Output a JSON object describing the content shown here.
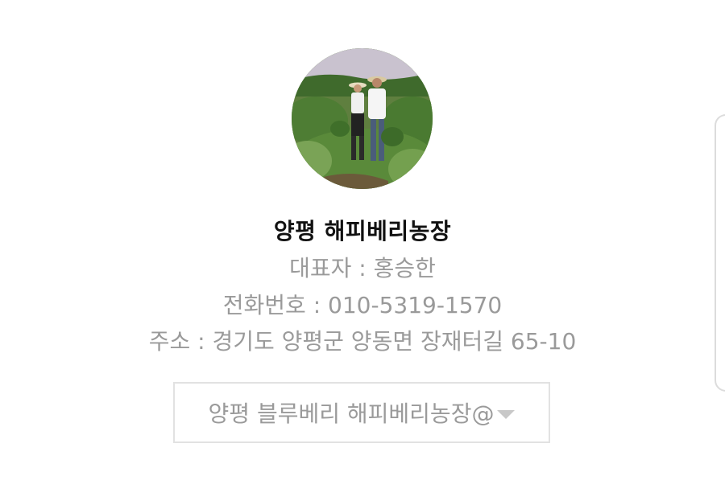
{
  "profile": {
    "farm_name": "양평 해피베리농장",
    "representative": "대표자 : 홍승한",
    "phone": "전화번호 : 010-5319-1570",
    "address": "주소 : 경기도 양평군 양동면 장재터길 65-10"
  },
  "selector": {
    "selected": "양평 블루베리 해피베리농장@",
    "icon": "caret-down-icon"
  },
  "colors": {
    "name_text": "#111111",
    "info_text": "#9a9a9a",
    "border": "#e2e2e2"
  }
}
